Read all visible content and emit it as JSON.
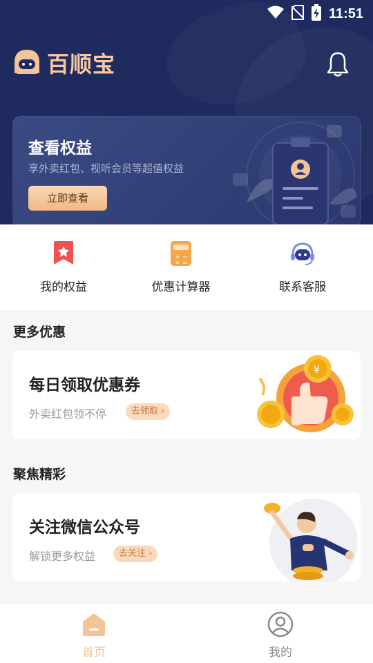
{
  "status_bar": {
    "time": "11:51",
    "icons": [
      "wifi-icon",
      "no-sim-icon",
      "battery-charging-icon"
    ]
  },
  "header": {
    "app_name": "百顺宝",
    "logo_icon": "robot-logo-icon",
    "bell_icon": "bell-icon"
  },
  "benefit_card": {
    "title": "查看权益",
    "subtitle": "享外卖红包、视听会员等超值权益",
    "button_label": "立即查看"
  },
  "quick_actions": [
    {
      "label": "我的权益",
      "icon": "star-bookmark-icon"
    },
    {
      "label": "优惠计算器",
      "icon": "calculator-icon"
    },
    {
      "label": "联系客服",
      "icon": "customer-service-icon"
    }
  ],
  "sections": {
    "more_deals": {
      "title": "更多优惠",
      "card": {
        "title": "每日领取优惠券",
        "subtitle": "外卖红包领不停",
        "tag": "去领取 ›"
      }
    },
    "featured": {
      "title": "聚焦精彩",
      "card": {
        "title": "关注微信公众号",
        "subtitle": "解锁更多权益",
        "tag": "去关注 ›"
      }
    }
  },
  "tabbar": {
    "items": [
      {
        "label": "首页",
        "icon": "home-icon",
        "active": true
      },
      {
        "label": "我的",
        "icon": "profile-icon",
        "active": false
      }
    ]
  },
  "colors": {
    "header_bg": "#1f2a5e",
    "accent": "#f0b887",
    "tab_active": "#f3c497",
    "tab_inactive": "#888888"
  }
}
